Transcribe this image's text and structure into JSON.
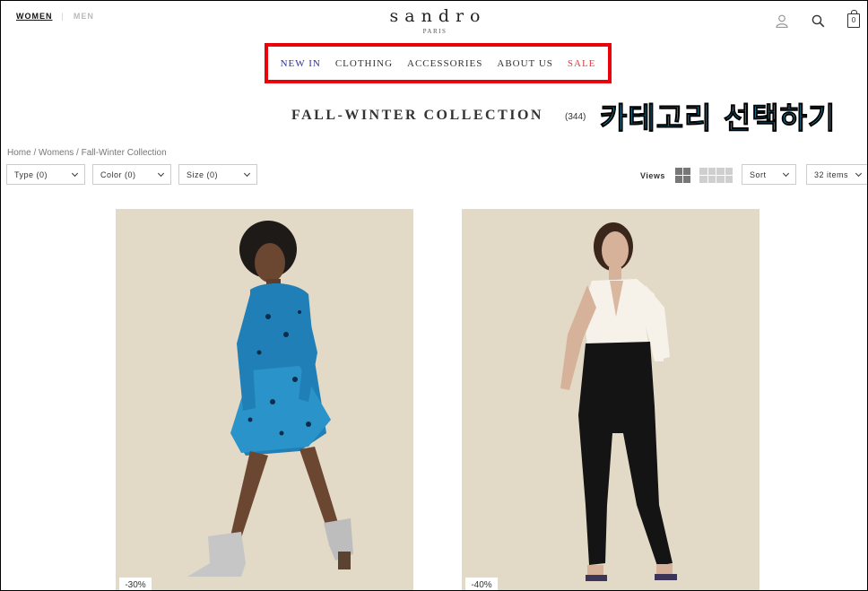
{
  "header": {
    "gender_women": "WOMEN",
    "gender_men": "MEN",
    "logo_name": "sandro",
    "logo_sub": "PARIS",
    "bag_count": "0"
  },
  "nav": {
    "items": [
      "NEW IN",
      "CLOTHING",
      "ACCESSORIES",
      "ABOUT US",
      "SALE"
    ]
  },
  "page": {
    "title": "FALL-WINTER COLLECTION",
    "count": "(344)",
    "annotation": "카테고리 선택하기",
    "breadcrumb": "Home / Womens / Fall-Winter Collection"
  },
  "filters": {
    "type": "Type (0)",
    "color": "Color (0)",
    "size": "Size (0)",
    "views_label": "Views",
    "sort": "Sort",
    "items_per_page": "32 items"
  },
  "products": [
    {
      "discount": "-30%"
    },
    {
      "discount": "-40%"
    }
  ],
  "colors": {
    "annotation_box": "#e8000b",
    "annotation_text": "#29b6e8",
    "new_in": "#2b2fa4",
    "sale": "#e53b3b",
    "product_bg": "#e2dac6"
  }
}
